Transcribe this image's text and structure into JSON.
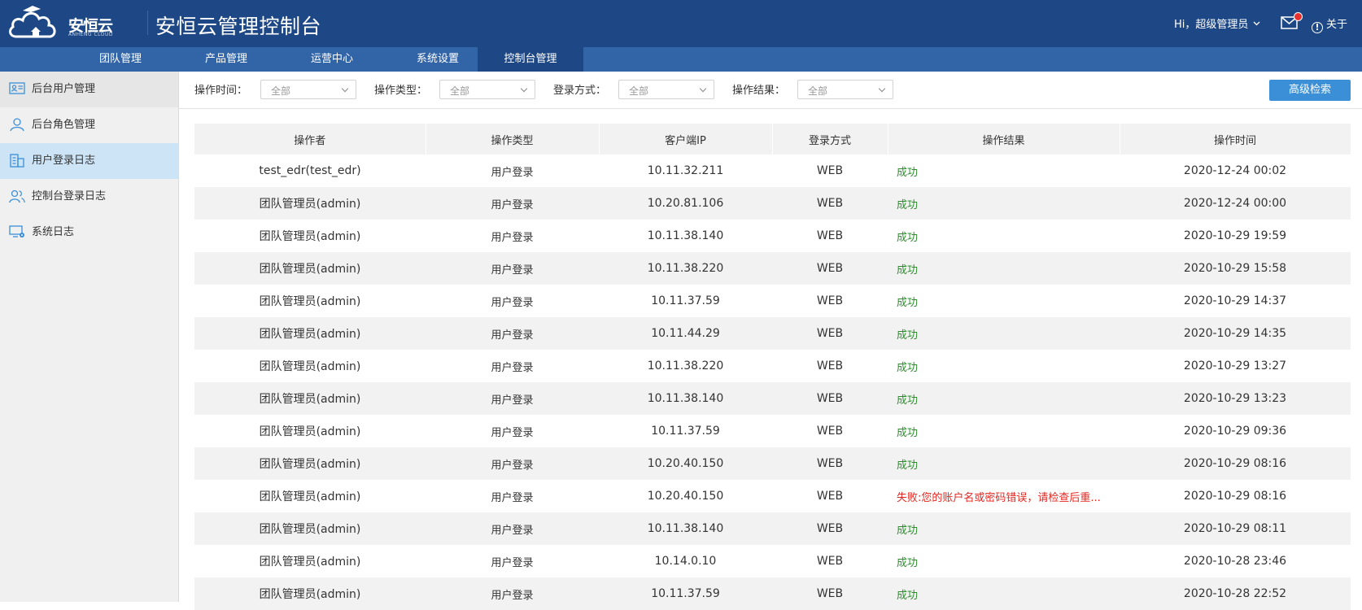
{
  "header": {
    "logo_text": "安恒云",
    "logo_sub": "ANHENG CLOUD",
    "app_title": "安恒云管理控制台",
    "user_greeting": "Hi，超级管理员",
    "about_label": "关于"
  },
  "topnav": {
    "tabs": [
      {
        "label": "团队管理"
      },
      {
        "label": "产品管理"
      },
      {
        "label": "运营中心"
      },
      {
        "label": "系统设置"
      },
      {
        "label": "控制台管理",
        "active": true
      }
    ]
  },
  "sidebar": {
    "items": [
      {
        "label": "后台用户管理",
        "icon": "user-card-icon"
      },
      {
        "label": "后台角色管理",
        "icon": "user-icon"
      },
      {
        "label": "用户登录日志",
        "icon": "building-icon",
        "active": true
      },
      {
        "label": "控制台登录日志",
        "icon": "users-icon"
      },
      {
        "label": "系统日志",
        "icon": "monitor-gear-icon"
      }
    ]
  },
  "filters": {
    "op_time_label": "操作时间：",
    "op_type_label": "操作类型：",
    "login_method_label": "登录方式：",
    "op_result_label": "操作结果：",
    "op_time_value": "全部",
    "op_type_value": "全部",
    "login_method_value": "全部",
    "op_result_value": "全部",
    "advanced_search": "高级检索"
  },
  "table": {
    "headers": [
      "操作者",
      "操作类型",
      "客户端IP",
      "登录方式",
      "操作结果",
      "操作时间"
    ],
    "rows": [
      [
        "test_edr(test_edr)",
        "用户登录",
        "10.11.32.211",
        "WEB",
        "成功",
        "2020-12-24 00:02"
      ],
      [
        "团队管理员(admin)",
        "用户登录",
        "10.20.81.106",
        "WEB",
        "成功",
        "2020-12-24 00:00"
      ],
      [
        "团队管理员(admin)",
        "用户登录",
        "10.11.38.140",
        "WEB",
        "成功",
        "2020-10-29 19:59"
      ],
      [
        "团队管理员(admin)",
        "用户登录",
        "10.11.38.220",
        "WEB",
        "成功",
        "2020-10-29 15:58"
      ],
      [
        "团队管理员(admin)",
        "用户登录",
        "10.11.37.59",
        "WEB",
        "成功",
        "2020-10-29 14:37"
      ],
      [
        "团队管理员(admin)",
        "用户登录",
        "10.11.44.29",
        "WEB",
        "成功",
        "2020-10-29 14:35"
      ],
      [
        "团队管理员(admin)",
        "用户登录",
        "10.11.38.220",
        "WEB",
        "成功",
        "2020-10-29 13:27"
      ],
      [
        "团队管理员(admin)",
        "用户登录",
        "10.11.38.140",
        "WEB",
        "成功",
        "2020-10-29 13:23"
      ],
      [
        "团队管理员(admin)",
        "用户登录",
        "10.11.37.59",
        "WEB",
        "成功",
        "2020-10-29 09:36"
      ],
      [
        "团队管理员(admin)",
        "用户登录",
        "10.20.40.150",
        "WEB",
        "成功",
        "2020-10-29 08:16"
      ],
      [
        "团队管理员(admin)",
        "用户登录",
        "10.20.40.150",
        "WEB",
        "失败:您的账户名或密码错误，请检查后重...",
        "2020-10-29 08:16"
      ],
      [
        "团队管理员(admin)",
        "用户登录",
        "10.11.38.140",
        "WEB",
        "成功",
        "2020-10-29 08:11"
      ],
      [
        "团队管理员(admin)",
        "用户登录",
        "10.14.0.10",
        "WEB",
        "成功",
        "2020-10-28 23:46"
      ],
      [
        "团队管理员(admin)",
        "用户登录",
        "10.11.37.59",
        "WEB",
        "成功",
        "2020-10-28 22:52"
      ]
    ]
  },
  "colors": {
    "header_bg": "#1e4885",
    "nav_bg": "#3265a8",
    "success": "#2d8c2d",
    "fail": "#e6261f",
    "button": "#3a8fd7"
  }
}
